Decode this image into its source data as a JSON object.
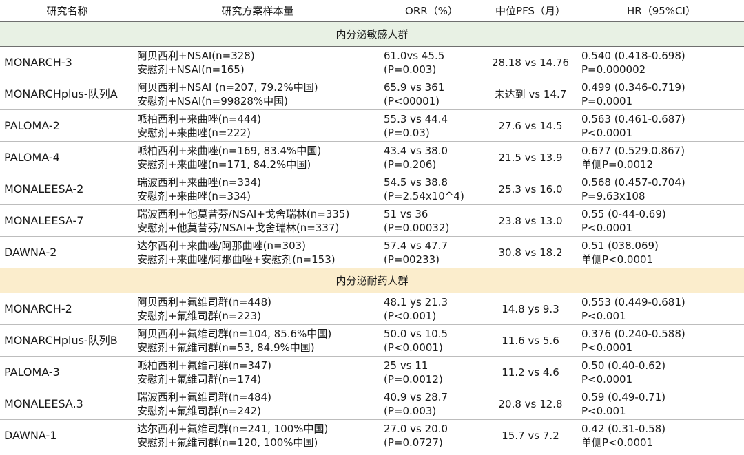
{
  "headers": [
    "研究名称",
    "研究方案样本量",
    "ORR（%）",
    "中位PFS（月）",
    "HR（95%CI）"
  ],
  "sections": [
    {
      "title": "内分泌敏感人群",
      "rows": [
        {
          "name": "MONARCH-3",
          "plan": [
            "阿贝西利+NSAI(n=328)",
            "安慰剂+NSAI(n=165)"
          ],
          "orr": [
            "61.0vs 45.5",
            "(P=0.003)"
          ],
          "pfs": "28.18 vs 14.76",
          "hr": [
            "0.540 (0.418-0.698)",
            "P=0.000002"
          ]
        },
        {
          "name": "MONARCHplus-队列A",
          "plan": [
            "阿贝西利+NSAI (n=207, 79.2%中国)",
            "安慰剂+NSAI(n=99828%中国)"
          ],
          "orr": [
            "65.9 vs 361",
            "(P<00001)"
          ],
          "pfs": "未达到 vs 14.7",
          "hr": [
            "0.499 (0.346-0.719)",
            "P=0.0001"
          ]
        },
        {
          "name": "PALOMA-2",
          "plan": [
            "哌柏西利+来曲唑(n=444)",
            "安慰剂+来曲唑(n=222)"
          ],
          "orr": [
            "55.3 vs 44.4",
            " (P=0.03)"
          ],
          "pfs": "27.6 vs 14.5",
          "hr": [
            "0.563 (0.461-0.687)",
            "P<0.0001"
          ]
        },
        {
          "name": "PALOMA-4",
          "plan": [
            "哌柏西利+来曲唑(n=169, 83.4%中国)",
            "安慰剂+来曲唑(n=171, 84.2%中国)"
          ],
          "orr": [
            "43.4 vs 38.0",
            " (P=0.206)"
          ],
          "pfs": "21.5 vs 13.9",
          "hr": [
            "0.677 (0.529.0.867)",
            "单侧P=0.0012"
          ]
        },
        {
          "name": "MONALEESA-2",
          "plan": [
            "瑞波西利+来曲唑(n=334)",
            "安慰剂+来曲唑(n=334)"
          ],
          "orr": [
            "54.5 vs 38.8",
            "(P=2.54x10^4)"
          ],
          "pfs": "25.3 vs 16.0",
          "hr": [
            "0.568 (0.457-0.704)",
            "P=9.63x108"
          ]
        },
        {
          "name": "MONALEESA-7",
          "plan": [
            "瑞波西利+他莫昔芬/NSAI+戈舍瑞林(n=335)",
            "安慰剂+他莫昔芬/NSAI+戈舍瑞林(n=337)"
          ],
          "orr": [
            "51 vs 36",
            "(P=0.00032)"
          ],
          "pfs": "23.8 vs 13.0",
          "hr": [
            "0.55 (0-44-0.69)",
            "P<0.0001"
          ]
        },
        {
          "name": "DAWNA-2",
          "plan": [
            "达尔西利+来曲唑/阿那曲唑(n=303)",
            "安慰剂+来曲唑/阿那曲唑+安慰剂(n=153)"
          ],
          "orr": [
            "57.4 vs 47.7",
            " (P=00233)"
          ],
          "pfs": "30.8 vs 18.2",
          "hr": [
            "0.51 (038.069)",
            "单侧P<0.0001"
          ]
        }
      ]
    },
    {
      "title": "内分泌耐药人群",
      "rows": [
        {
          "name": "MONARCH-2",
          "plan": [
            "阿贝西利+氟维司群(n=448)",
            "安慰剂+氟维司群(n=223)"
          ],
          "orr": [
            "48.1 ys 21.3",
            "(P<0.001)"
          ],
          "pfs": "14.8 ys 9.3",
          "hr": [
            "0.553 (0.449-0.681)",
            "P<0.001"
          ]
        },
        {
          "name": "MONARCHplus-队列B",
          "plan": [
            "阿贝西利+氟维司群(n=104, 85.6%中国)",
            "安慰剂+氟维司群(n=53, 84.9%中国)"
          ],
          "orr": [
            "50.0 vs 10.5",
            "(P<0.0001)"
          ],
          "pfs": "11.6 vs 5.6",
          "hr": [
            "0.376  (0.240-0.588)",
            "P<0.0001"
          ]
        },
        {
          "name": "PALOMA-3",
          "plan": [
            "哌柏西利+氟维司群(n=347)",
            "安慰剂+氟维司群(n=174)"
          ],
          "orr": [
            "25 vs 11",
            "(P=0.0012)"
          ],
          "pfs": "11.2 vs 4.6",
          "hr": [
            "0.50 (0.40-0.62)",
            "P<0.0001"
          ]
        },
        {
          "name": "MONALEESA.3",
          "plan": [
            "瑞波西利+氟维司群(n=484)",
            "安慰剂+氟维司群(n=242)"
          ],
          "orr": [
            "40.9 vs 28.7",
            "(P=0.003)"
          ],
          "pfs": "20.8 vs 12.8",
          "hr": [
            "0.59  (0.49-0.71)",
            " P<0.001"
          ]
        },
        {
          "name": "DAWNA-1",
          "plan": [
            "达尔西利+氟维司群(n=241, 100%中国)",
            "安慰剂+氟维司群(n=120, 100%中国)"
          ],
          "orr": [
            "27.0 vs 20.0",
            "(P=0.0727)"
          ],
          "pfs": "15.7 vs 7.2",
          "hr": [
            "0.42  (0.31-0.58)",
            "单侧P<0.0001"
          ]
        }
      ]
    }
  ]
}
